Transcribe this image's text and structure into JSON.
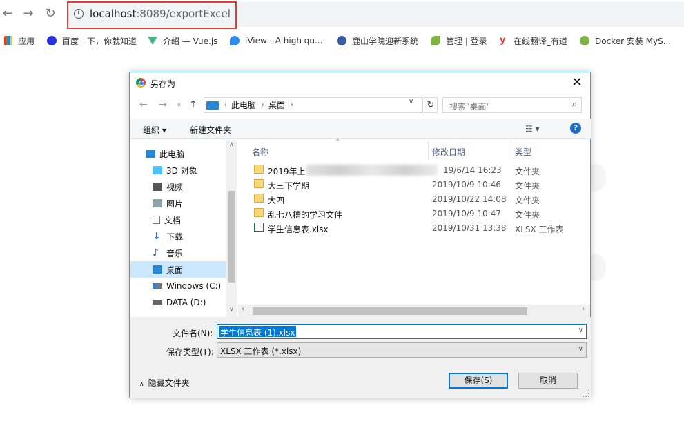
{
  "browser": {
    "url_host": "localhost",
    "url_rest": ":8089/exportExcel",
    "bookmarks": [
      "应用",
      "百度一下，你就知道",
      "介绍 — Vue.js",
      "iView - A high qu...",
      "鹿山学院迎新系统",
      "管理 | 登录",
      "在线翻译_有道",
      "Docker 安装 MyS..."
    ]
  },
  "dialog": {
    "title": "另存为",
    "breadcrumb": [
      "此电脑",
      "桌面"
    ],
    "search_placeholder": "搜索\"桌面\"",
    "commands": {
      "organize": "组织 ▾",
      "new_folder": "新建文件夹"
    },
    "nav_items": [
      "此电脑",
      "3D 对象",
      "视频",
      "图片",
      "文档",
      "下载",
      "音乐",
      "桌面",
      "Windows (C:)",
      "DATA (D:)"
    ],
    "selected_nav": "桌面",
    "columns": [
      "名称",
      "修改日期",
      "类型"
    ],
    "files": [
      {
        "name": "2019年上",
        "date": "19/6/14 16:23",
        "type": "文件夹",
        "kind": "folder"
      },
      {
        "name": "大三下学期",
        "date": "2019/10/9 10:46",
        "type": "文件夹",
        "kind": "folder"
      },
      {
        "name": "大四",
        "date": "2019/10/22 14:08",
        "type": "文件夹",
        "kind": "folder"
      },
      {
        "name": "乱七八糟的学习文件",
        "date": "2019/10/9 10:47",
        "type": "文件夹",
        "kind": "folder"
      },
      {
        "name": "学生信息表.xlsx",
        "date": "2019/10/31 13:38",
        "type": "XLSX 工作表",
        "kind": "xlsx"
      }
    ],
    "filename_label": "文件名(N):",
    "filename_value": "学生信息表 (1).xlsx",
    "filetype_label": "保存类型(T):",
    "filetype_value": "XLSX 工作表 (*.xlsx)",
    "hide_folders": "隐藏文件夹",
    "save_label": "保存(S)",
    "cancel_label": "取消"
  },
  "colors": {
    "accent": "#0078d7",
    "highlight_box": "#e53935",
    "selected_nav": "#cce8ff"
  }
}
